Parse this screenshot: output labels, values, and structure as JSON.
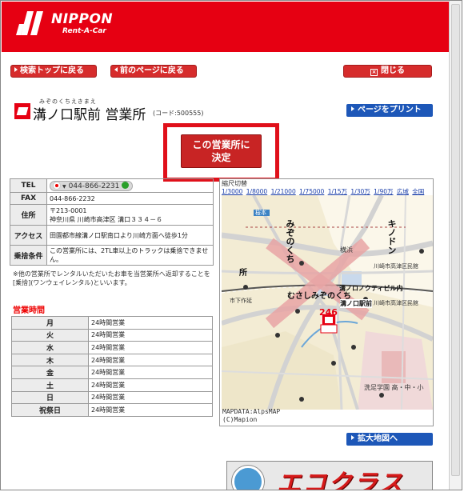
{
  "brand": {
    "name": "NIPPON",
    "sub": "Rent-A-Car",
    "color": "#e60012"
  },
  "nav": {
    "back_to_search": "検索トップに戻る",
    "back_prev": "前のページに戻る",
    "close": "閉じる",
    "print": "ページをプリント",
    "enlarge_map": "拡大地図へ"
  },
  "office": {
    "ruby": "みぞのくちえきまえ",
    "name": "溝ノ口駅前 営業所",
    "code": "(コード:500555)",
    "decide_line1": "この営業所に",
    "decide_line2": "決定"
  },
  "info": {
    "tel_label": "TEL",
    "tel": "044-866-2231",
    "fax_label": "FAX",
    "fax": "044-866-2232",
    "address_label": "住所",
    "postal": "〒213-0001",
    "address": "神奈川県 川崎市高津区 溝口３３４－６",
    "access_label": "アクセス",
    "access": "田園都市線溝ノ口駅南口より川崎方面へ徒歩1分",
    "condition_label": "乗捨条件",
    "condition": "この営業所には、2TL車以上のトラックは乗捨できません。",
    "note": "※他の営業所でレンタルいただいたお車を当営業所へ返却することを[乗捨](ワンウェイレンタル)といいます。"
  },
  "hours": {
    "title": "営業時間",
    "rows": [
      {
        "day": "月",
        "time": "24時間営業"
      },
      {
        "day": "火",
        "time": "24時間営業"
      },
      {
        "day": "水",
        "time": "24時間営業"
      },
      {
        "day": "木",
        "time": "24時間営業"
      },
      {
        "day": "金",
        "time": "24時間営業"
      },
      {
        "day": "土",
        "time": "24時間営業"
      },
      {
        "day": "日",
        "time": "24時間営業"
      },
      {
        "day": "祝祭日",
        "time": "24時間営業"
      }
    ]
  },
  "map": {
    "scale_head": "縮尺切替",
    "scales": [
      "1/3000",
      "1/8000",
      "1/21000",
      "1/75000",
      "1/15万",
      "1/30万",
      "1/90万",
      "広域",
      "全国"
    ],
    "labels": {
      "mizonokuchi": "みぞのくち",
      "musashi": "むさしみぞのくち",
      "kinodon": "キノドン",
      "office": "溝ノ口駅前",
      "building": "溝ノロノクティビル内",
      "gov1": "川崎市高津区民館",
      "gov2": "川崎市高津区民館",
      "hospital": "横浜",
      "school": "洗足学園 高・中・小",
      "branch": "所",
      "route": "246",
      "sakuracho": "桜本",
      "hikakun": "市下作延"
    },
    "credit1": "MAPDATA:AlpsMAP",
    "credit2": "(C)Mapion"
  },
  "banner": {
    "text": "エコクラス"
  }
}
